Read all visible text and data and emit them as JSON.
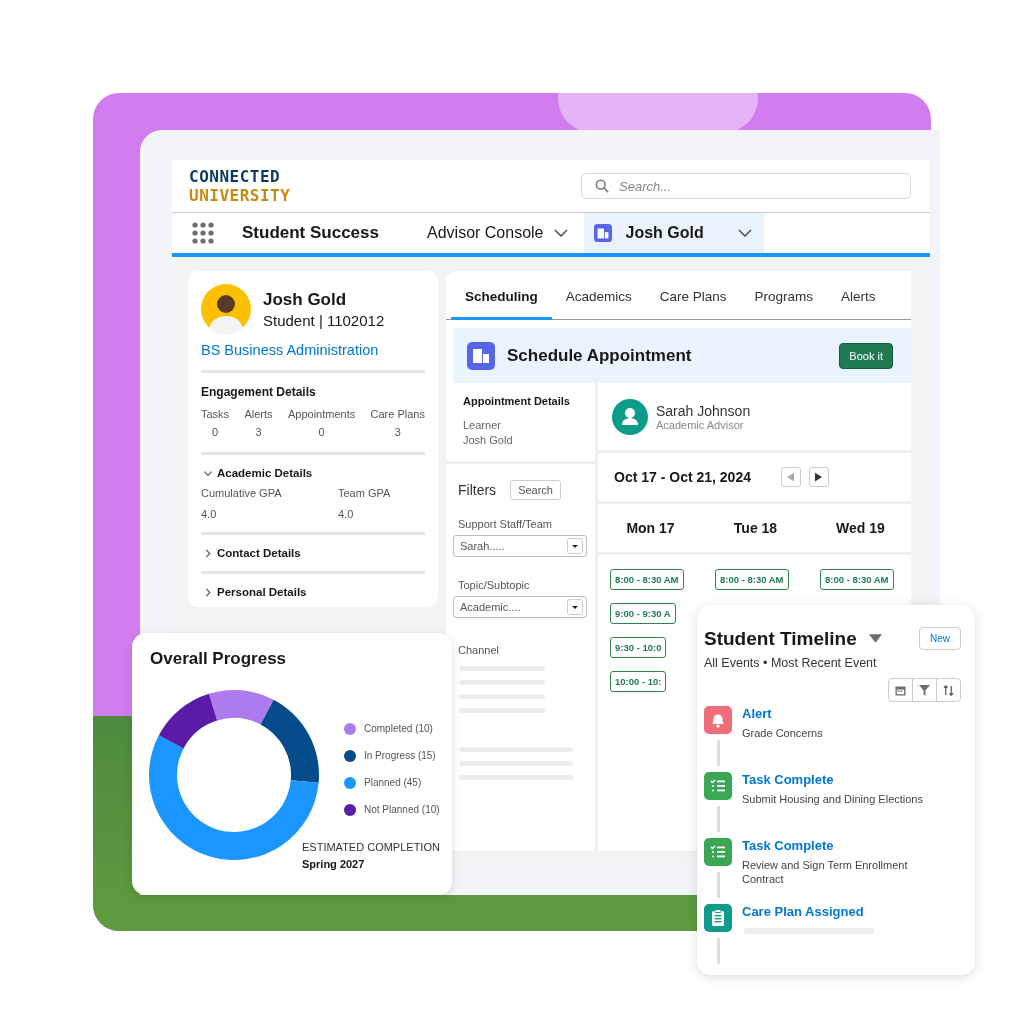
{
  "brand": {
    "line_1": "CONNECTED",
    "line_2": "UNIVERSITY"
  },
  "search": {
    "placeholder": "Search..."
  },
  "nav": {
    "app_name": "Student Success",
    "items": [
      {
        "label": "Advisor Console",
        "selected": false
      },
      {
        "label": "Josh Gold",
        "selected": true
      }
    ]
  },
  "profile": {
    "name": "Josh Gold",
    "subtitle": "Student | 1102012",
    "program": "BS Business Administration",
    "engagement": {
      "title": "Engagement Details",
      "stats": [
        {
          "label": "Tasks",
          "value": "0"
        },
        {
          "label": "Alerts",
          "value": "3"
        },
        {
          "label": "Appointments",
          "value": "0"
        },
        {
          "label": "Care Plans",
          "value": "3"
        }
      ]
    },
    "sections": [
      {
        "title": "Academic Details",
        "expanded": true,
        "fields": [
          {
            "label": "Cumulative GPA",
            "value": "4.0"
          },
          {
            "label": "Team GPA",
            "value": "4.0"
          }
        ]
      },
      {
        "title": "Contact Details",
        "expanded": false
      },
      {
        "title": "Personal Details",
        "expanded": false
      }
    ]
  },
  "tabs": [
    {
      "label": "Scheduling",
      "selected": true
    },
    {
      "label": "Academics",
      "selected": false
    },
    {
      "label": "Care Plans",
      "selected": false
    },
    {
      "label": "Programs",
      "selected": false
    },
    {
      "label": "Alerts",
      "selected": false
    }
  ],
  "schedule": {
    "title": "Schedule Appointment",
    "button": "Book it",
    "details": {
      "title": "Appointment Details",
      "label": "Learner",
      "value": "Josh Gold"
    },
    "filters": {
      "title": "Filters",
      "button": "Search",
      "fields": [
        {
          "label": "Support Staff/Team",
          "value": "Sarah....."
        },
        {
          "label": "Topic/Subtopic",
          "value": "Academic...."
        }
      ],
      "channel_label": "Channel"
    },
    "advisor": {
      "name": "Sarah Johnson",
      "role": "Academic Advisor"
    },
    "date_range": "Oct 17 - Oct 21, 2024",
    "days": [
      {
        "label": "Mon 17",
        "slots": [
          "8:00 - 8:30 AM",
          "9:00 - 9:30 A",
          "9:30 - 10:0",
          "10:00 - 10:"
        ]
      },
      {
        "label": "Tue 18",
        "slots": [
          "8:00 - 8:30 AM"
        ]
      },
      {
        "label": "Wed 19",
        "slots": [
          "8:00 - 8:30 AM"
        ]
      }
    ]
  },
  "progress": {
    "title": "Overall Progress",
    "chart_data": {
      "type": "donut",
      "categories": [
        "Completed (10)",
        "In Progress (15)",
        "Planned (45)",
        "Not Planned (10)"
      ],
      "values": [
        10,
        15,
        45,
        10
      ]
    },
    "legend": [
      {
        "color": "#ad7bee"
      },
      {
        "color": "#034b8a"
      },
      {
        "color": "#1b96ff"
      },
      {
        "color": "#5a1ba9"
      }
    ],
    "estimate_label": "ESTIMATED COMPLETION",
    "estimate_value": "Spring 2027"
  },
  "timeline": {
    "title": "Student Timeline",
    "button": "New",
    "subtitle": "All Events • Most Recent Event",
    "events": [
      {
        "kind": "alert",
        "title": "Alert",
        "detail": "Grade Concerns"
      },
      {
        "kind": "task",
        "title": "Task Complete",
        "detail": "Submit Housing and Dining Elections"
      },
      {
        "kind": "task",
        "title": "Task Complete",
        "detail": "Review and Sign Term Enrollment Contract"
      },
      {
        "kind": "care_plan",
        "title": "Care Plan Assigned"
      }
    ]
  }
}
